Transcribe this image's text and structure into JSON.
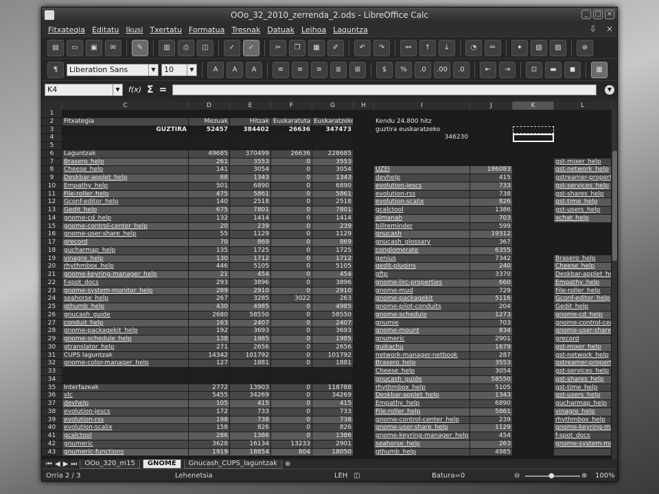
{
  "window": {
    "title": "OOo_32_2010_zerrenda_2.ods - LibreOffice Calc"
  },
  "menu": [
    "Fitxategia",
    "Editatu",
    "Ikusi",
    "Txertatu",
    "Formatua",
    "Tresnak",
    "Datuak",
    "Leihoa",
    "Laguntza"
  ],
  "format": {
    "font_name": "Liberation Sans",
    "font_size": "10"
  },
  "formula": {
    "name_box": "K4",
    "fx": "f(x)",
    "sum": "Σ",
    "eq": "="
  },
  "columns": [
    "C",
    "D",
    "E",
    "F",
    "G",
    "H",
    "I",
    "J",
    "K",
    "L"
  ],
  "rows": [
    {
      "n": "1",
      "c": [
        "",
        "",
        "",
        "",
        "",
        "",
        "",
        "",
        "",
        ""
      ]
    },
    {
      "n": "2",
      "c": [
        "Fitxategia",
        "Mezuak",
        "Hitzak",
        "Euskaratuta",
        "Euskaratzeko",
        "",
        "Kendu 24.800 hitz",
        "",
        "",
        ""
      ]
    },
    {
      "n": "3",
      "c": [
        "GUZTIRA",
        "52457",
        "384402",
        "26636",
        "347473",
        "",
        "guztira euskaratzeko",
        "",
        "",
        ""
      ]
    },
    {
      "n": "4",
      "c": [
        "",
        "",
        "",
        "",
        "",
        "",
        "346230",
        "",
        "",
        ""
      ]
    },
    {
      "n": "5",
      "c": [
        "",
        "",
        "",
        "",
        "",
        "",
        "",
        "",
        "",
        ""
      ]
    },
    {
      "n": "6",
      "c": [
        "Laguntzak",
        "49685",
        "370499",
        "26636",
        "228685",
        "",
        "",
        "",
        "",
        ""
      ]
    },
    {
      "n": "7",
      "c": [
        "Brasero_help",
        "261",
        "3553",
        "0",
        "3553",
        "",
        "",
        "",
        "",
        "gst-mixer_help"
      ]
    },
    {
      "n": "8",
      "c": [
        "Cheese_help",
        "141",
        "3054",
        "0",
        "3054",
        "",
        "UZEI",
        "186083",
        "",
        "gst-network_help"
      ]
    },
    {
      "n": "9",
      "c": [
        "Deskbar-applet_help",
        "88",
        "1343",
        "0",
        "1343",
        "",
        "devhelp",
        "415",
        "",
        "gstreamer-properties_h"
      ]
    },
    {
      "n": "10",
      "c": [
        "Empathy_help",
        "501",
        "6890",
        "0",
        "6890",
        "",
        "evolution-jescs",
        "733",
        "",
        "gst-services_help"
      ]
    },
    {
      "n": "11",
      "c": [
        "File-roller_help",
        "475",
        "5861",
        "0",
        "5861",
        "",
        "evolution-rss",
        "738",
        "",
        "gst-shares_help"
      ]
    },
    {
      "n": "12",
      "c": [
        "Gconf-editor_help",
        "140",
        "2518",
        "0",
        "2518",
        "",
        "evolution-scalix",
        "826",
        "",
        "gst-time_help"
      ]
    },
    {
      "n": "13",
      "c": [
        "Gedit_help",
        "675",
        "7801",
        "0",
        "7801",
        "",
        "gcalctool",
        "1386",
        "",
        "gst-users_help"
      ]
    },
    {
      "n": "14",
      "c": [
        "gnome-cd_help",
        "132",
        "1414",
        "0",
        "1414",
        "",
        "almanah",
        "703",
        "",
        "xchat_help"
      ]
    },
    {
      "n": "15",
      "c": [
        "gnome-control-center_help",
        "20",
        "239",
        "0",
        "239",
        "",
        "billreminder",
        "599",
        "",
        ""
      ]
    },
    {
      "n": "16",
      "c": [
        "gnome-user-share_help",
        "55",
        "1129",
        "0",
        "1129",
        "",
        "gnucash",
        "19312",
        "",
        ""
      ]
    },
    {
      "n": "17",
      "c": [
        "grecord",
        "70",
        "869",
        "0",
        "869",
        "",
        "gnucash_glossary",
        "367",
        "",
        ""
      ]
    },
    {
      "n": "18",
      "c": [
        "gucharmap_help",
        "135",
        "1725",
        "0",
        "1725",
        "",
        "conglomerate",
        "6355",
        "",
        ""
      ]
    },
    {
      "n": "19",
      "c": [
        "vinagre_help",
        "130",
        "1712",
        "0",
        "1712",
        "",
        "genius",
        "7342",
        "",
        "Brasero_help"
      ]
    },
    {
      "n": "20",
      "c": [
        "rhythmbox_help",
        "446",
        "5105",
        "0",
        "5105",
        "",
        "gedit-plugins",
        "240",
        "",
        "Cheese_help"
      ]
    },
    {
      "n": "21",
      "c": [
        "gnome-keyring-manager_help",
        "21",
        "454",
        "0",
        "454",
        "",
        "gftp",
        "3370",
        "",
        "Deskbar-applet_help"
      ]
    },
    {
      "n": "22",
      "c": [
        "f-spot_docs",
        "293",
        "3896",
        "0",
        "3896",
        "",
        "gnome-lirc-properties",
        "660",
        "",
        "Empathy_help"
      ]
    },
    {
      "n": "23",
      "c": [
        "gnome-system-monitor_help",
        "289",
        "2910",
        "0",
        "2910",
        "",
        "gnome-mud",
        "729",
        "",
        "File-roller_help"
      ]
    },
    {
      "n": "24",
      "c": [
        "seahorse_help",
        "267",
        "3285",
        "3022",
        "263",
        "",
        "gnome-packagekit",
        "5116",
        "",
        "Gconf-editor_help"
      ]
    },
    {
      "n": "25",
      "c": [
        "gthumb_help",
        "430",
        "4985",
        "0",
        "4985",
        "",
        "gnome-pilot-conduits",
        "204",
        "",
        "Gedit_help"
      ]
    },
    {
      "n": "26",
      "c": [
        "gnucash_guide",
        "2680",
        "58550",
        "0",
        "58550",
        "",
        "gnome-schedule",
        "1273",
        "",
        "gnome-cd_help"
      ]
    },
    {
      "n": "27",
      "c": [
        "conduit_help",
        "163",
        "2407",
        "0",
        "2407",
        "",
        "gnumie",
        "703",
        "",
        "gnome-control-center_h"
      ]
    },
    {
      "n": "28",
      "c": [
        "gnome-packagekit_help",
        "192",
        "3693",
        "0",
        "3693",
        "",
        "gnome-mount",
        "834",
        "",
        "gnome-user-share_help"
      ]
    },
    {
      "n": "29",
      "c": [
        "gnome-schedule_help",
        "138",
        "1985",
        "0",
        "1985",
        "",
        "gnumeric",
        "2901",
        "",
        "grecord"
      ]
    },
    {
      "n": "30",
      "c": [
        "gtranslator_help",
        "271",
        "2656",
        "0",
        "2656",
        "",
        "guikachu",
        "1679",
        "",
        "gst-mixer_help"
      ]
    },
    {
      "n": "31",
      "c": [
        "CUPS laguntzak",
        "14342",
        "101792",
        "0",
        "101792",
        "",
        "network-manager-netbook",
        "287",
        "",
        "gst-network_help"
      ]
    },
    {
      "n": "32",
      "c": [
        "gnome-color-manager_help",
        "127",
        "1881",
        "0",
        "1881",
        "",
        "Brasero_help",
        "3553",
        "",
        "gstreamer-properties_h"
      ]
    },
    {
      "n": "33",
      "c": [
        "",
        "",
        "",
        "",
        "",
        "",
        "Cheese_help",
        "3054",
        "",
        "gst-services_help"
      ]
    },
    {
      "n": "34",
      "c": [
        "",
        "",
        "",
        "",
        "",
        "",
        "gnucash_guide",
        "58550",
        "",
        "gst-shares_help"
      ]
    },
    {
      "n": "35",
      "c": [
        "Interfazeak",
        "2772",
        "13903",
        "0",
        "118788",
        "",
        "rhythmbox_help",
        "5105",
        "",
        "gst-time_help"
      ]
    },
    {
      "n": "36",
      "c": [
        "vlc",
        "5455",
        "34269",
        "0",
        "34269",
        "",
        "Deskbar-applet_help",
        "1343",
        "",
        "gst-users_help"
      ]
    },
    {
      "n": "37",
      "c": [
        "devhelp",
        "105",
        "415",
        "0",
        "415",
        "",
        "Empathy_help",
        "6890",
        "",
        "gucharmap_help"
      ]
    },
    {
      "n": "38",
      "c": [
        "evolution-jescs",
        "172",
        "733",
        "0",
        "733",
        "",
        "File-roller_help",
        "5861",
        "",
        "vinagre_help"
      ]
    },
    {
      "n": "39",
      "c": [
        "evolution-rss",
        "198",
        "738",
        "0",
        "738",
        "",
        "gnome-control-center_help",
        "239",
        "",
        "rhythmbox_help"
      ]
    },
    {
      "n": "40",
      "c": [
        "evolution-scalix",
        "158",
        "826",
        "0",
        "826",
        "",
        "gnome-user-share_help",
        "1129",
        "",
        "gnome-keyring-manage"
      ]
    },
    {
      "n": "41",
      "c": [
        "gcalctool",
        "286",
        "1386",
        "0",
        "1386",
        "",
        "gnome-keyring-manager_help",
        "454",
        "",
        "f-spot_docs"
      ]
    },
    {
      "n": "42",
      "c": [
        "gnumeric",
        "3628",
        "16134",
        "13233",
        "2901",
        "",
        "seahorse_help",
        "263",
        "",
        "gnome-system-monitor_"
      ]
    },
    {
      "n": "43",
      "c": [
        "gnumeric-functions",
        "1919",
        "18854",
        "804",
        "18050",
        "",
        "gthumb_help",
        "4985",
        "",
        ""
      ]
    }
  ],
  "sheets": [
    "OOo_320_m15",
    "GNOME",
    "Gnucash_CUPS_laguntzak"
  ],
  "status": {
    "page": "Orria 2 / 3",
    "style": "Lehenetsia",
    "lang": "LEH",
    "sum": "Batura=0",
    "zoom": "100%"
  }
}
